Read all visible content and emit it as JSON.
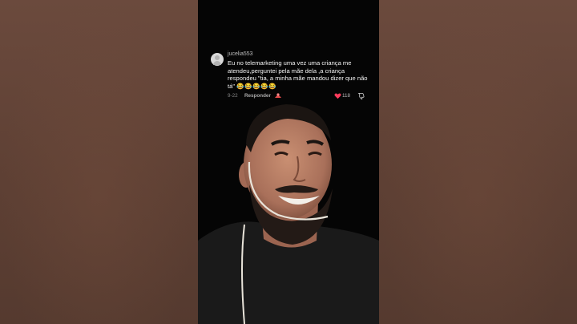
{
  "comment": {
    "username": "jucelia553",
    "text": "Eu no telemarketing uma vez uma criança me atendeu,perguntei pela mãe dela ,a criança respondeu \"tia, a minha mãe mandou dizer que não tá\"",
    "emojis": "😂😂😂😂😂",
    "date": "9-22",
    "reply_label": "Responder",
    "likes": "118"
  },
  "icons": {
    "avatar": "user-avatar-icon",
    "react": "react-sticker-icon",
    "like": "heart-icon",
    "dislike": "thumbs-down-icon"
  },
  "colors": {
    "like": "#ff3b5c",
    "background_blur": "#5a3e33",
    "video_bg": "#050505"
  }
}
